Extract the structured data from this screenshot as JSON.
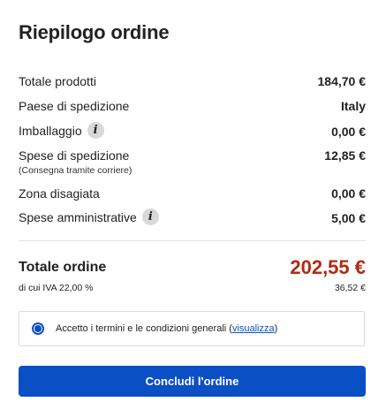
{
  "title": "Riepilogo ordine",
  "rows": [
    {
      "label": "Totale prodotti",
      "value": "184,70 €"
    },
    {
      "label": "Paese di spedizione",
      "value": "Italy"
    },
    {
      "label": "Imballaggio",
      "value": "0,00 €",
      "icon": "info-icon"
    },
    {
      "label": "Spese di spedizione",
      "sublabel": "(Consegna tramite corriere)",
      "value": "12,85 €"
    },
    {
      "label": "Zona disagiata",
      "value": "0,00 €"
    },
    {
      "label": "Spese amministrative",
      "value": "5,00 €",
      "icon": "info-icon"
    }
  ],
  "info_glyph": "i",
  "total": {
    "label": "Totale ordine",
    "value": "202,55 €"
  },
  "vat": {
    "label": "di cui IVA 22,00 %",
    "value": "36,52 €"
  },
  "terms": {
    "text": "Accetto i termini e le condizioni generali (",
    "link": "visualizza",
    "close": ")",
    "checked": true
  },
  "cta": {
    "label": "Concludi l'ordine"
  },
  "colors": {
    "accent": "#0b4fc4",
    "total": "#b22a13"
  }
}
